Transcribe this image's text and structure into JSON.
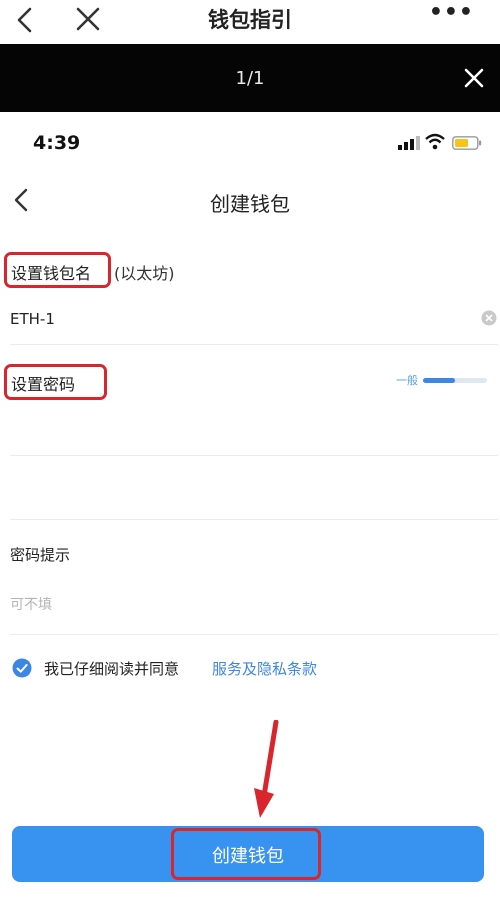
{
  "header": {
    "title": "钱包指引",
    "more_label": "•••"
  },
  "viewer": {
    "page_counter": "1/1"
  },
  "phone": {
    "status": {
      "time": "4:39"
    },
    "nav": {
      "title": "创建钱包"
    },
    "form": {
      "wallet_name_label": "设置钱包名",
      "wallet_name_suffix": "(以太坊)",
      "wallet_name_value": "ETH-1",
      "password_label": "设置密码",
      "strength_label": "一般",
      "strength_level": 0.5,
      "password_hint_label": "密码提示",
      "password_hint_placeholder": "可不填"
    },
    "agreement": {
      "checked": true,
      "text": "我已仔细阅读并同意",
      "link": "服务及隐私条款"
    },
    "create_button_label": "创建钱包"
  },
  "colors": {
    "accent": "#3892ef",
    "link": "#3d86e4",
    "highlight": "#d9262c",
    "viewer_bg": "#050505"
  },
  "icons": [
    "back-icon",
    "close-icon",
    "more-icon",
    "viewer-close-icon",
    "signal-icon",
    "wifi-icon",
    "battery-icon",
    "nav-back-icon",
    "clear-icon",
    "checkbox-checked-icon",
    "annotation-arrow"
  ]
}
